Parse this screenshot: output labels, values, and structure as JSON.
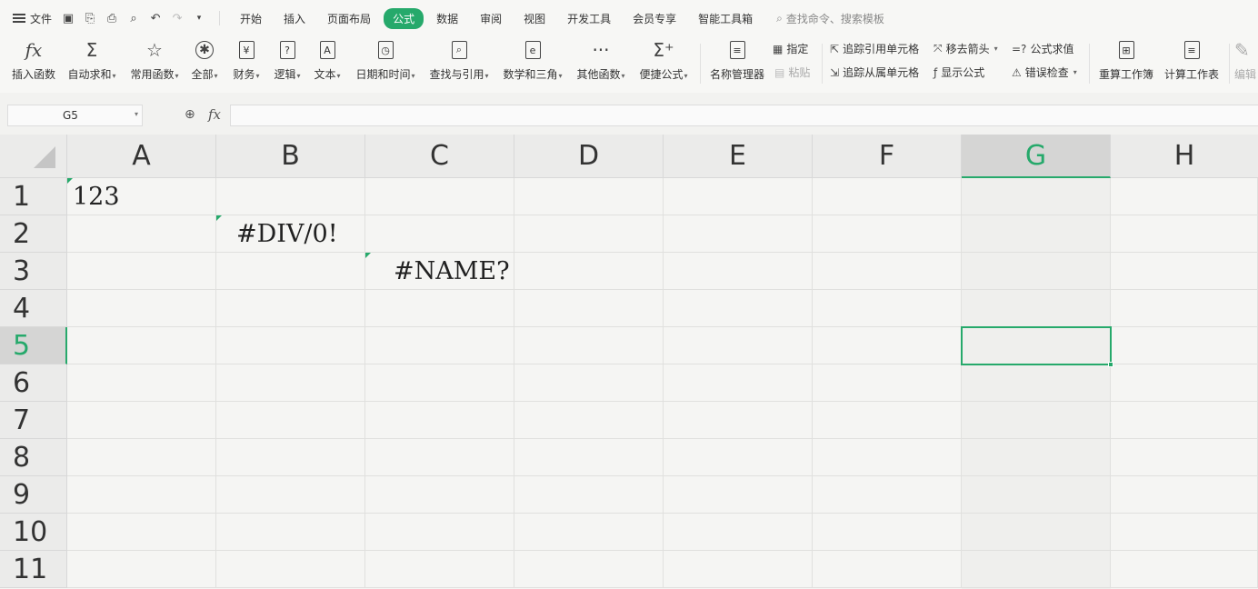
{
  "menu": {
    "file_label": "文件",
    "tabs": [
      "开始",
      "插入",
      "页面布局",
      "公式",
      "数据",
      "审阅",
      "视图",
      "开发工具",
      "会员专享",
      "智能工具箱"
    ],
    "active_tab": "公式",
    "search_placeholder": "查找命令、搜索模板"
  },
  "ribbon": {
    "insert_function": "插入函数",
    "autosum": "自动求和",
    "common_functions": "常用函数",
    "all": "全部",
    "financial": "财务",
    "logical": "逻辑",
    "text": "文本",
    "datetime": "日期和时间",
    "lookup": "查找与引用",
    "math": "数学和三角",
    "other": "其他函数",
    "quick_formula": "便捷公式",
    "name_manager": "名称管理器",
    "specify": "指定",
    "paste": "粘贴",
    "trace_precedents": "追踪引用单元格",
    "trace_dependents": "追踪从属单元格",
    "remove_arrows": "移去箭头",
    "show_formulas": "显示公式",
    "evaluate_formula": "公式求值",
    "error_checking": "错误检查",
    "recalc_workbook": "重算工作簿",
    "calc_sheet": "计算工作表",
    "edit": "编辑"
  },
  "formula_bar": {
    "name_box": "G5",
    "fx": "fx",
    "content": ""
  },
  "sheet": {
    "columns": [
      "A",
      "B",
      "C",
      "D",
      "E",
      "F",
      "G",
      "H"
    ],
    "rows": [
      "1",
      "2",
      "3",
      "4",
      "5",
      "6",
      "7",
      "8",
      "9",
      "10",
      "11"
    ],
    "selected_column": "G",
    "selected_row": "5",
    "cells": {
      "A1": "123",
      "B2": "#DIV/0!",
      "C3": "#NAME?"
    }
  },
  "colors": {
    "accent": "#26a96b"
  }
}
